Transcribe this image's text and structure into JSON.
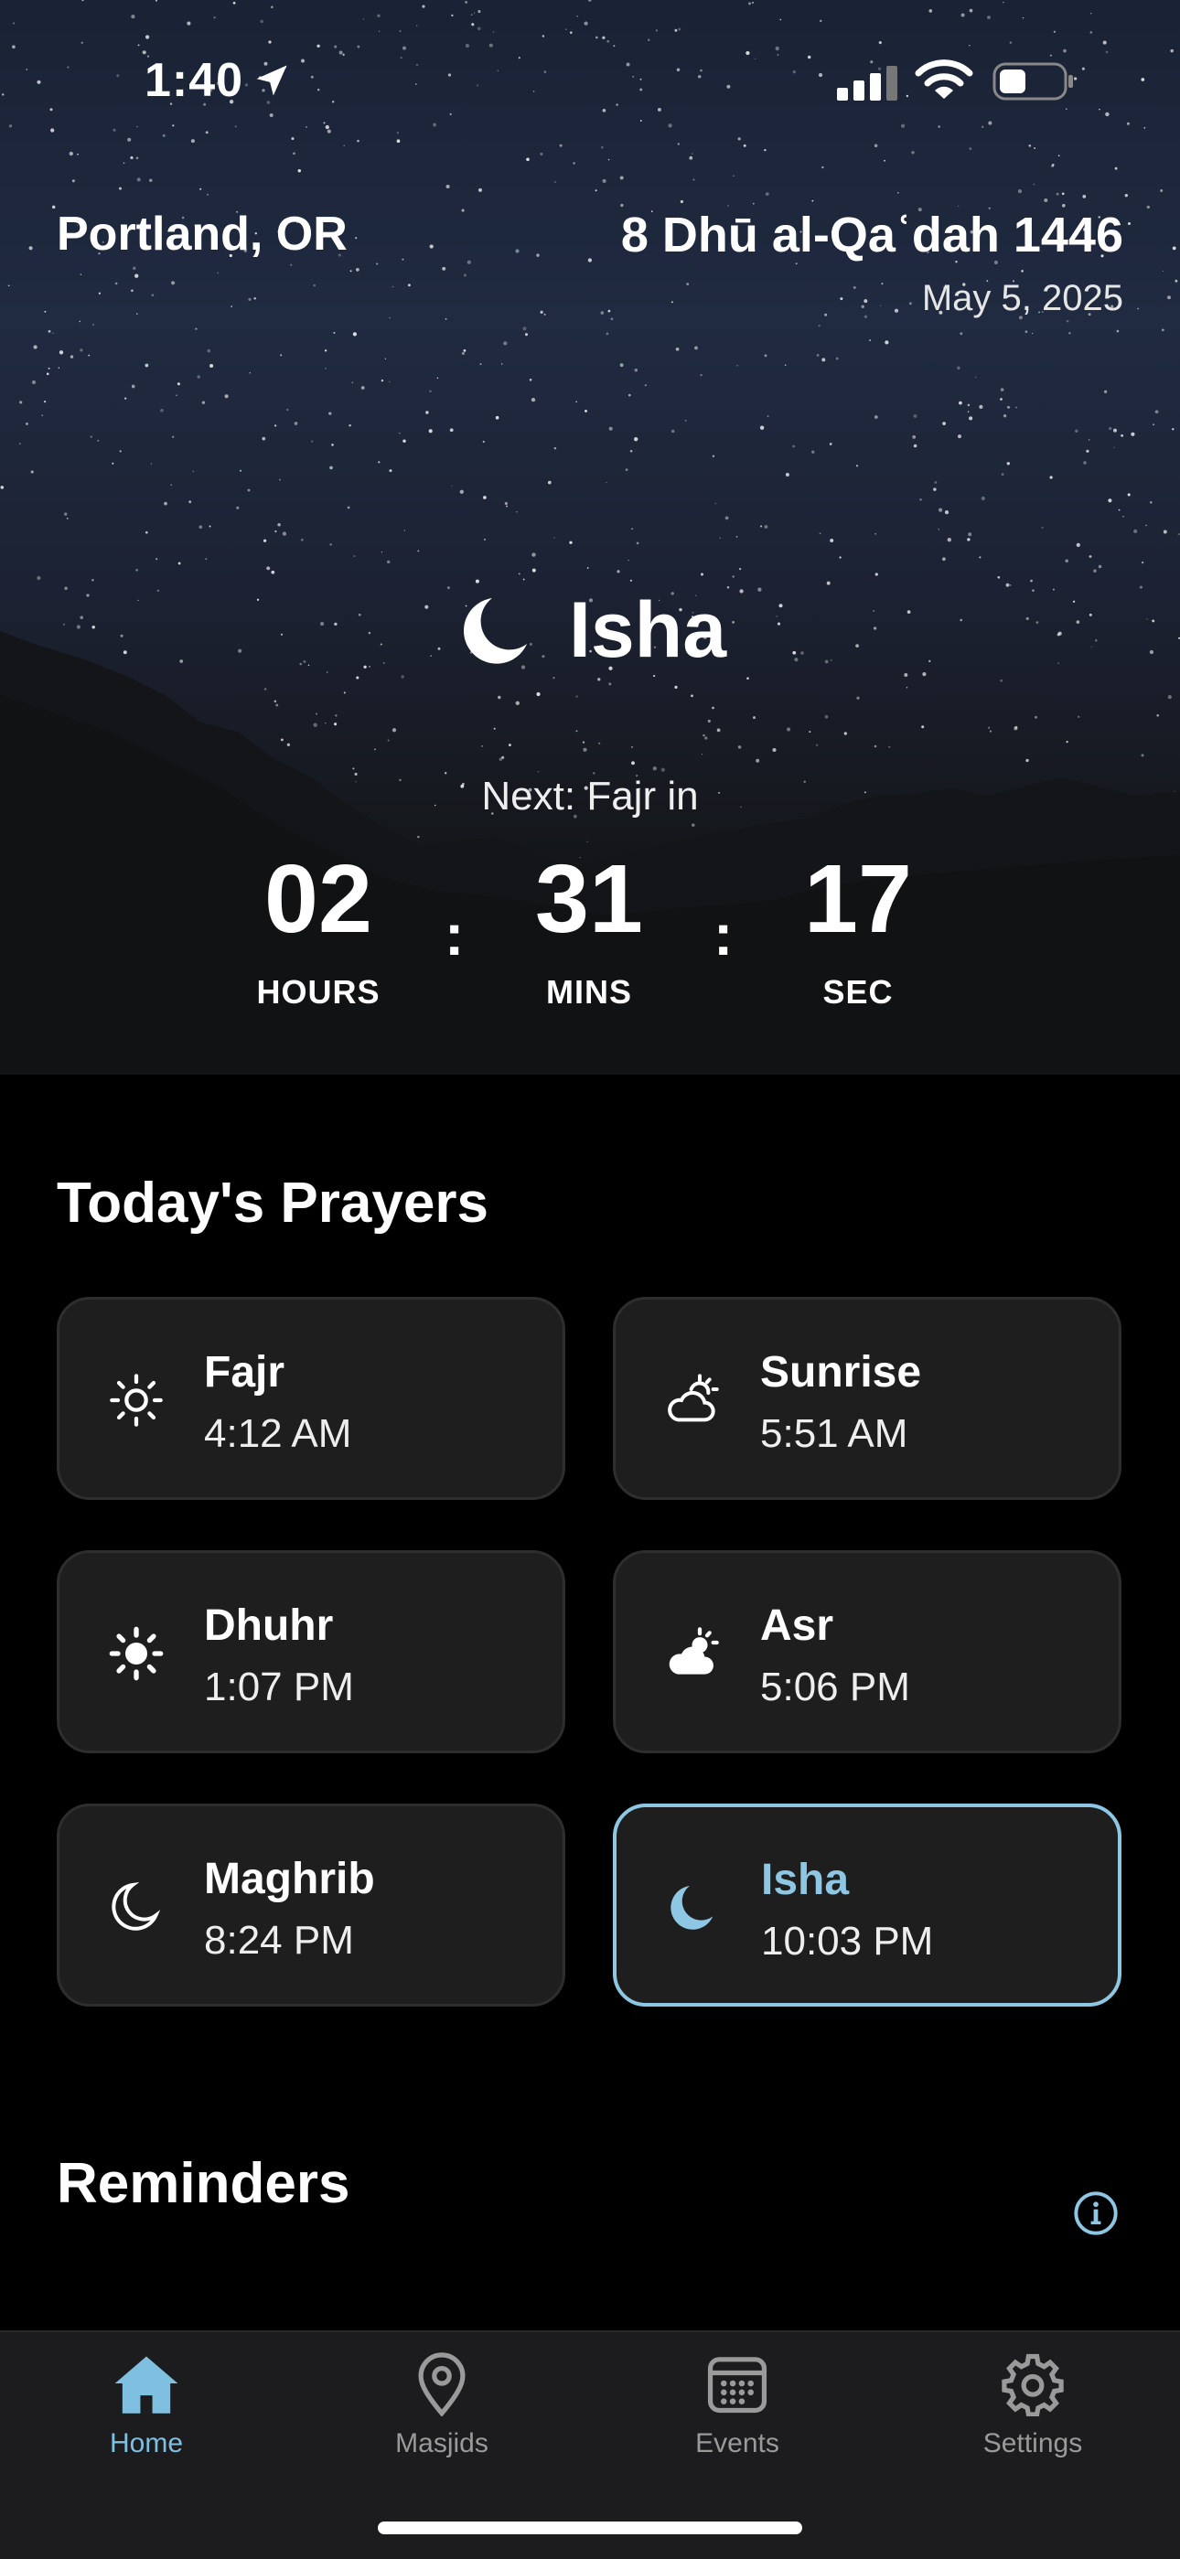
{
  "status_bar": {
    "time": "1:40"
  },
  "header": {
    "location": "Portland, OR",
    "hijri_date": "8 Dhū al-Qaʿdah 1446",
    "gregorian_date": "May 5, 2025"
  },
  "current_prayer": {
    "name": "Isha",
    "icon": "moon-icon"
  },
  "countdown": {
    "label": "Next: Fajr in",
    "hours": "02",
    "hours_label": "HOURS",
    "mins": "31",
    "mins_label": "MINS",
    "secs": "17",
    "secs_label": "SEC",
    "separator": ":"
  },
  "prayers_section": {
    "title": "Today's Prayers",
    "items": [
      {
        "name": "Fajr",
        "time": "4:12 AM",
        "icon": "sun-outline-icon"
      },
      {
        "name": "Sunrise",
        "time": "5:51 AM",
        "icon": "sun-cloud-outline-icon"
      },
      {
        "name": "Dhuhr",
        "time": "1:07 PM",
        "icon": "sun-icon"
      },
      {
        "name": "Asr",
        "time": "5:06 PM",
        "icon": "sun-cloud-icon"
      },
      {
        "name": "Maghrib",
        "time": "8:24 PM",
        "icon": "moon-outline-icon"
      },
      {
        "name": "Isha",
        "time": "10:03 PM",
        "icon": "moon-icon",
        "active": true
      }
    ]
  },
  "reminders": {
    "title": "Reminders"
  },
  "tabs": [
    {
      "label": "Home",
      "icon": "house-icon",
      "active": true
    },
    {
      "label": "Masjids",
      "icon": "location-pin-icon"
    },
    {
      "label": "Events",
      "icon": "calendar-icon"
    },
    {
      "label": "Settings",
      "icon": "gear-icon"
    }
  ],
  "colors": {
    "accent": "#8dc7e3",
    "card_bg": "#1e1e1e",
    "tabbar_bg": "#1c1c1e"
  }
}
